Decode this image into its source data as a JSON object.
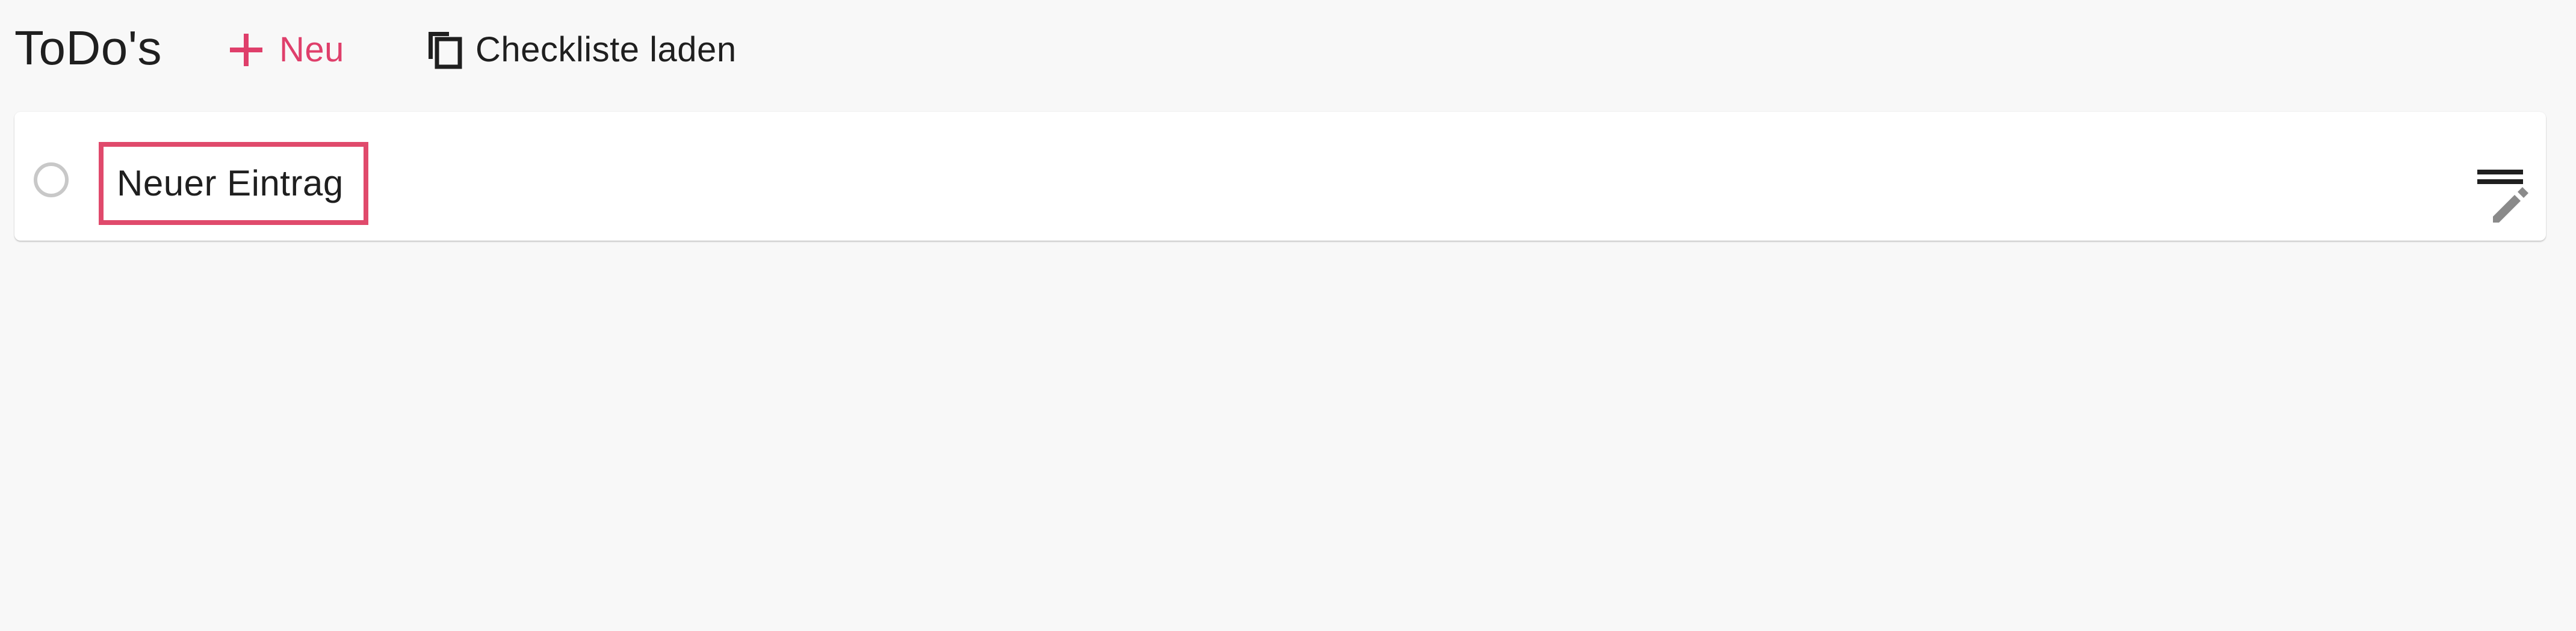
{
  "header": {
    "title": "ToDo's",
    "new_button_label": "Neu",
    "load_checklist_label": "Checkliste laden"
  },
  "todos": [
    {
      "text": "Neuer Eintrag",
      "completed": false
    }
  ],
  "colors": {
    "accent": "#df3f6b",
    "highlight_border": "#e04a6c",
    "background": "#f8f8f8",
    "card": "#ffffff",
    "text": "#1f1f1f",
    "checkbox_border": "#c8c8c8",
    "edit_icon": "#8a8a8a"
  },
  "icons": {
    "new": "plus-icon",
    "load_checklist": "copy-icon",
    "checkbox": "circle-checkbox-icon",
    "drag": "drag-handle-icon",
    "edit": "pencil-icon"
  }
}
